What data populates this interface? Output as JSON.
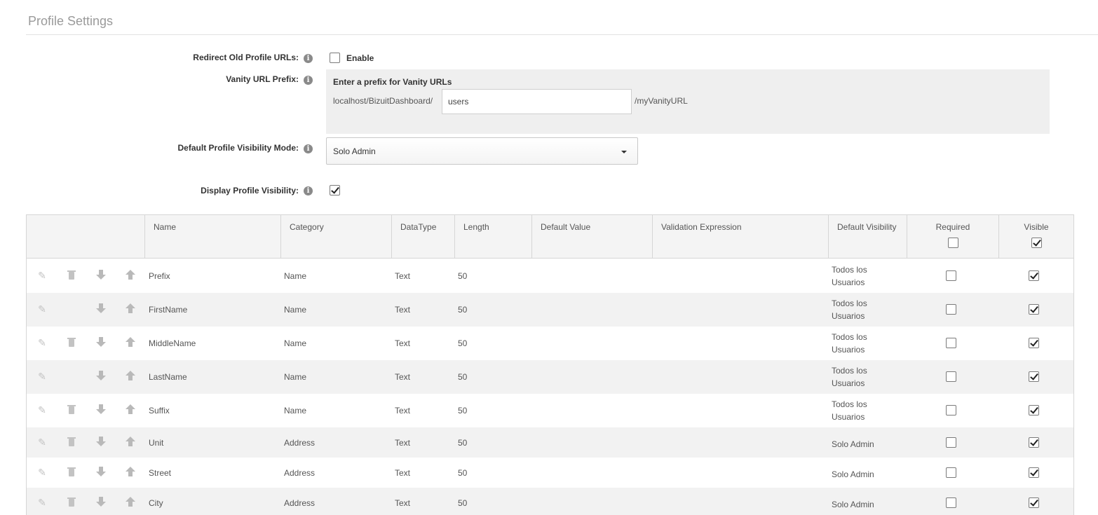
{
  "page": {
    "title": "Profile Settings"
  },
  "redirect": {
    "label": "Redirect Old Profile URLs:",
    "checkbox_label": "Enable",
    "checked": false
  },
  "vanity": {
    "label": "Vanity URL Prefix:",
    "heading": "Enter a prefix for Vanity URLs",
    "base_url": "localhost/BizuitDashboard/",
    "value": "users",
    "suffix": "/myVanityURL"
  },
  "visibility_mode": {
    "label": "Default Profile Visibility Mode:",
    "selected": "Solo Admin"
  },
  "display_visibility": {
    "label": "Display Profile Visibility:",
    "checked": true
  },
  "table": {
    "headers": {
      "name": "Name",
      "category": "Category",
      "datatype": "DataType",
      "length": "Length",
      "default_value": "Default Value",
      "validation": "Validation Expression",
      "default_visibility": "Default Visibility",
      "required": "Required",
      "visible": "Visible"
    },
    "header_required_checked": false,
    "header_visible_checked": true,
    "rows": [
      {
        "name": "Prefix",
        "category": "Name",
        "datatype": "Text",
        "length": "50",
        "default_value": "",
        "validation": "",
        "visibility": "Todos los Usuarios",
        "required": false,
        "visible": true,
        "deletable": true
      },
      {
        "name": "FirstName",
        "category": "Name",
        "datatype": "Text",
        "length": "50",
        "default_value": "",
        "validation": "",
        "visibility": "Todos los Usuarios",
        "required": false,
        "visible": true,
        "deletable": false
      },
      {
        "name": "MiddleName",
        "category": "Name",
        "datatype": "Text",
        "length": "50",
        "default_value": "",
        "validation": "",
        "visibility": "Todos los Usuarios",
        "required": false,
        "visible": true,
        "deletable": true
      },
      {
        "name": "LastName",
        "category": "Name",
        "datatype": "Text",
        "length": "50",
        "default_value": "",
        "validation": "",
        "visibility": "Todos los Usuarios",
        "required": false,
        "visible": true,
        "deletable": false
      },
      {
        "name": "Suffix",
        "category": "Name",
        "datatype": "Text",
        "length": "50",
        "default_value": "",
        "validation": "",
        "visibility": "Todos los Usuarios",
        "required": false,
        "visible": true,
        "deletable": true
      },
      {
        "name": "Unit",
        "category": "Address",
        "datatype": "Text",
        "length": "50",
        "default_value": "",
        "validation": "",
        "visibility": "Solo Admin",
        "required": false,
        "visible": true,
        "deletable": true
      },
      {
        "name": "Street",
        "category": "Address",
        "datatype": "Text",
        "length": "50",
        "default_value": "",
        "validation": "",
        "visibility": "Solo Admin",
        "required": false,
        "visible": true,
        "deletable": true
      },
      {
        "name": "City",
        "category": "Address",
        "datatype": "Text",
        "length": "50",
        "default_value": "",
        "validation": "",
        "visibility": "Solo Admin",
        "required": false,
        "visible": true,
        "deletable": true
      }
    ]
  }
}
